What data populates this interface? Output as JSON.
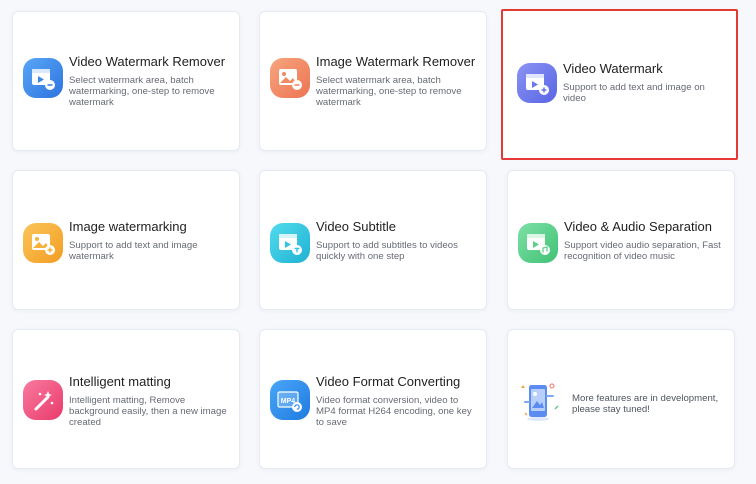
{
  "tools": [
    {
      "title": "Video Watermark Remover",
      "desc": "Select watermark area, batch watermarking, one-step to remove watermark",
      "icon": "video-watermark-remover-icon",
      "color": "#3f87e8"
    },
    {
      "title": "Image Watermark Remover",
      "desc": "Select watermark area, batch watermarking, one-step to remove watermark",
      "icon": "image-watermark-remover-icon",
      "color": "#f08a63"
    },
    {
      "title": "Video Watermark",
      "desc": "Support to add text and image on video",
      "icon": "video-watermark-icon",
      "color": "#6c79ec"
    },
    {
      "title": "Image watermarking",
      "desc": "Support to add text and image watermark",
      "icon": "image-watermarking-icon",
      "color": "#f5b13c"
    },
    {
      "title": "Video Subtitle",
      "desc": "Support to add subtitles to videos quickly with one step",
      "icon": "video-subtitle-icon",
      "color": "#2fc6de"
    },
    {
      "title": "Video & Audio Separation",
      "desc": "Support video audio separation, Fast recognition of video music",
      "icon": "video-audio-separation-icon",
      "color": "#5ed08d"
    },
    {
      "title": "Intelligent matting",
      "desc": "Intelligent matting, Remove background easily, then a new image created",
      "icon": "intelligent-matting-icon",
      "color": "#f2517e"
    },
    {
      "title": "Video Format Converting",
      "desc": "Video format conversion, video to MP4 format H264 encoding, one key to save",
      "icon": "video-format-converting-icon",
      "color": "#2a8cee",
      "badge": "MP4"
    }
  ],
  "more": {
    "text": "More features are in development, please stay tuned!",
    "icon": "in-development-illustration-icon"
  }
}
